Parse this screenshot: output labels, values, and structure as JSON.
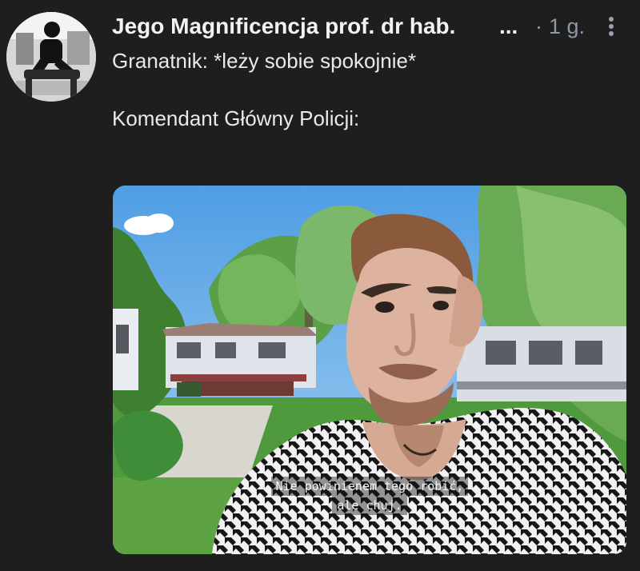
{
  "tweet": {
    "author": "Jego Magnificencja prof. dr hab.",
    "ellipsis": "...",
    "separator": "·",
    "time": "1 g.",
    "text_lines": [
      "Granatnik: *leży sobie spokojnie*",
      "Komendant Główny Policji:"
    ]
  },
  "media": {
    "subtitle_lines": [
      "Nie powinienem tego robić,",
      "ale chuj."
    ]
  },
  "icons": {
    "more": "more-vertical-icon"
  },
  "colors": {
    "background": "#1e1e1f",
    "text": "#e7e9ea",
    "secondary": "#8b98a5"
  }
}
